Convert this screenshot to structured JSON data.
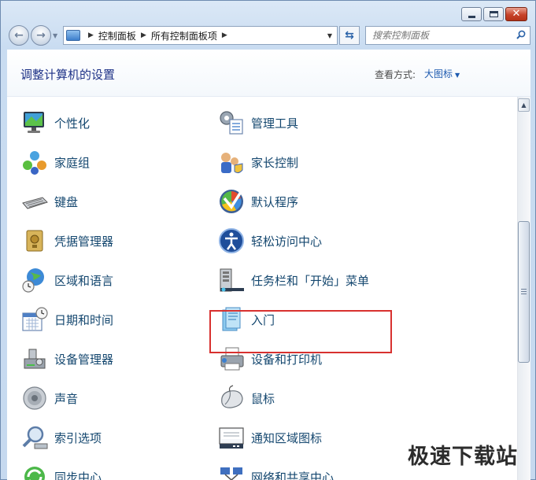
{
  "window": {
    "minimize_icon": "minimize-icon",
    "maximize_icon": "maximize-icon",
    "close_label": "✕"
  },
  "nav": {
    "back_icon": "back-arrow-icon",
    "forward_icon": "forward-arrow-icon",
    "breadcrumb": [
      "控制面板",
      "所有控制面板项"
    ],
    "refresh_icon": "refresh-icon",
    "search_placeholder": "搜索控制面板"
  },
  "header": {
    "title": "调整计算机的设置",
    "view_label": "查看方式:",
    "view_value": "大图标"
  },
  "items_left": [
    {
      "label": "个性化",
      "icon": "monitor-personalize-icon"
    },
    {
      "label": "家庭组",
      "icon": "homegroup-icon"
    },
    {
      "label": "键盘",
      "icon": "keyboard-icon"
    },
    {
      "label": "凭据管理器",
      "icon": "credential-safe-icon"
    },
    {
      "label": "区域和语言",
      "icon": "globe-clock-icon"
    },
    {
      "label": "日期和时间",
      "icon": "calendar-clock-icon"
    },
    {
      "label": "设备管理器",
      "icon": "device-manager-icon"
    },
    {
      "label": "声音",
      "icon": "speaker-icon"
    },
    {
      "label": "索引选项",
      "icon": "index-search-icon"
    },
    {
      "label": "同步中心",
      "icon": "sync-center-icon"
    }
  ],
  "items_right": [
    {
      "label": "管理工具",
      "icon": "admin-tools-icon"
    },
    {
      "label": "家长控制",
      "icon": "parental-control-icon"
    },
    {
      "label": "默认程序",
      "icon": "default-programs-icon"
    },
    {
      "label": "轻松访问中心",
      "icon": "ease-of-access-icon"
    },
    {
      "label": "任务栏和「开始」菜单",
      "icon": "taskbar-start-icon"
    },
    {
      "label": "入门",
      "icon": "getting-started-icon"
    },
    {
      "label": "设备和打印机",
      "icon": "printer-icon"
    },
    {
      "label": "鼠标",
      "icon": "mouse-icon"
    },
    {
      "label": "通知区域图标",
      "icon": "notification-area-icon"
    },
    {
      "label": "网络和共享中心",
      "icon": "network-icon"
    }
  ],
  "watermark": "极速下载站",
  "colors": {
    "link": "#14476f",
    "title": "#1e3287",
    "highlight": "#d8312f"
  }
}
